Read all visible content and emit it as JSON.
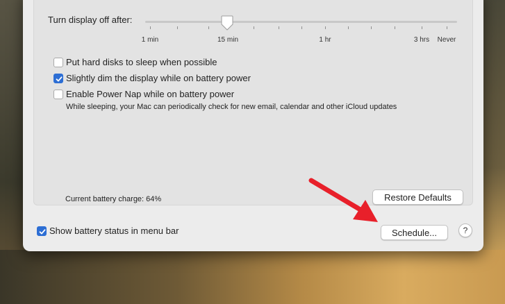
{
  "display": {
    "turn_off_label": "Turn display off after:",
    "slider_ticks": [
      "1 min",
      "15 min",
      "1 hr",
      "3 hrs",
      "Never"
    ],
    "slider_value": "15 min"
  },
  "options": {
    "hard_disks": {
      "label": "Put hard disks to sleep when possible",
      "checked": false
    },
    "dim_display": {
      "label": "Slightly dim the display while on battery power",
      "checked": true
    },
    "power_nap": {
      "label": "Enable Power Nap while on battery power",
      "checked": false,
      "description": "While sleeping, your Mac can periodically check for new email, calendar and other iCloud updates"
    }
  },
  "battery": {
    "charge_text": "Current battery charge: 64%"
  },
  "buttons": {
    "restore_defaults": "Restore Defaults",
    "schedule": "Schedule...",
    "help": "?"
  },
  "menu_bar": {
    "label": "Show battery status in menu bar",
    "checked": true
  },
  "colors": {
    "accent": "#2d6ed4",
    "annotation_arrow": "#e8202a"
  }
}
